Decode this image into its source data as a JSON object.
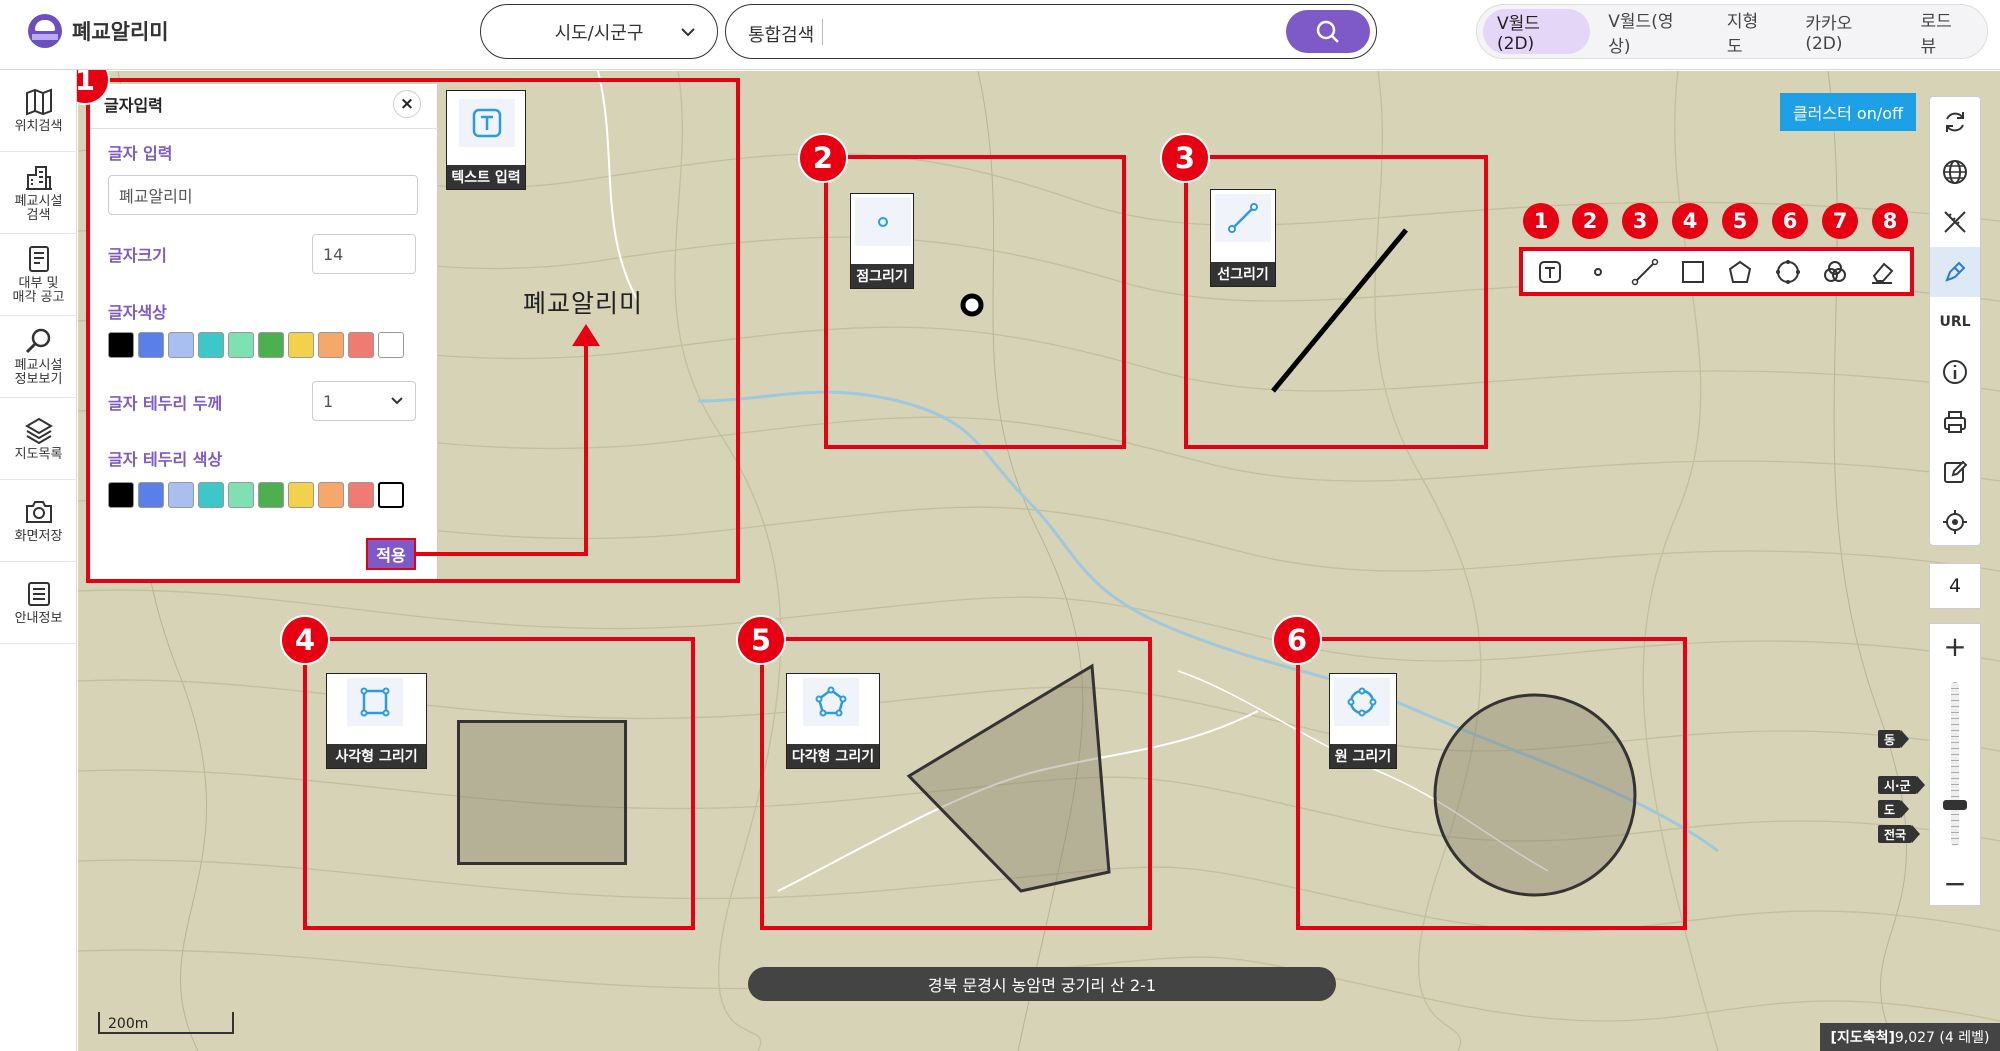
{
  "header": {
    "logo_text": "폐교알리미",
    "region_select": "시도/시군구",
    "search_label": "통합검색",
    "search_placeholder": "",
    "map_tabs": [
      "V월드(2D)",
      "V월드(영상)",
      "지형도",
      "카카오(2D)",
      "로드뷰"
    ],
    "active_tab": "V월드(2D)"
  },
  "sidebar": {
    "items": [
      {
        "label": "위치검색",
        "icon": "map-icon"
      },
      {
        "label": "폐교시설\n검색",
        "icon": "building-icon"
      },
      {
        "label": "대부 및\n매각 공고",
        "icon": "document-icon"
      },
      {
        "label": "폐교시설\n정보보기",
        "icon": "magnifier-icon"
      },
      {
        "label": "지도목록",
        "icon": "layers-icon"
      },
      {
        "label": "화면저장",
        "icon": "camera-icon"
      },
      {
        "label": "안내정보",
        "icon": "info-list-icon"
      }
    ]
  },
  "text_panel": {
    "title": "글자입력",
    "close_icon": "close-icon",
    "text_label": "글자 입력",
    "text_value": "폐교알리미",
    "size_label": "글자크기",
    "size_value": "14",
    "color_label": "글자색상",
    "colors": [
      "#000000",
      "#5b7fe8",
      "#a9bff2",
      "#3cc8c8",
      "#7fe0b4",
      "#4caf50",
      "#f2d24a",
      "#f6a86a",
      "#ef7b72",
      "#ffffff"
    ],
    "stroke_width_label": "글자 테두리 두께",
    "stroke_width_value": "1",
    "stroke_color_label": "글자 테두리 색상",
    "apply_label": "적용"
  },
  "annotations": {
    "box_numbers": [
      "1",
      "2",
      "3",
      "4",
      "5",
      "6"
    ],
    "toolbar_numbers": [
      "1",
      "2",
      "3",
      "4",
      "5",
      "6",
      "7",
      "8"
    ],
    "thumb_text": "텍스트 입력",
    "thumb_point": "점그리기",
    "thumb_line": "선그리기",
    "thumb_rect": "사각형 그리기",
    "thumb_polygon": "다각형 그리기",
    "thumb_circle": "원 그리기",
    "map_text": "폐교알리미"
  },
  "right_toolbar": {
    "cluster_label": "클러스터 on/off",
    "url_label": "URL",
    "level": "4",
    "zoom_in": "+",
    "zoom_out": "−",
    "zoom_level_fraction": 0.25,
    "scale_tags": [
      "동",
      "시·군",
      "도",
      "전국"
    ]
  },
  "map_info": {
    "address": "경북 문경시 농암면 궁기리 산 2-1",
    "scale_bar": "200m",
    "map_scale_label": "[지도축척]",
    "map_scale_value": " 9,027 (4 레벨)"
  },
  "colors": {
    "accent": "#7d5ac8",
    "annotation_red": "#e60012",
    "map_bg": "#d6d3b6",
    "cluster_blue": "#1ea0e6"
  }
}
